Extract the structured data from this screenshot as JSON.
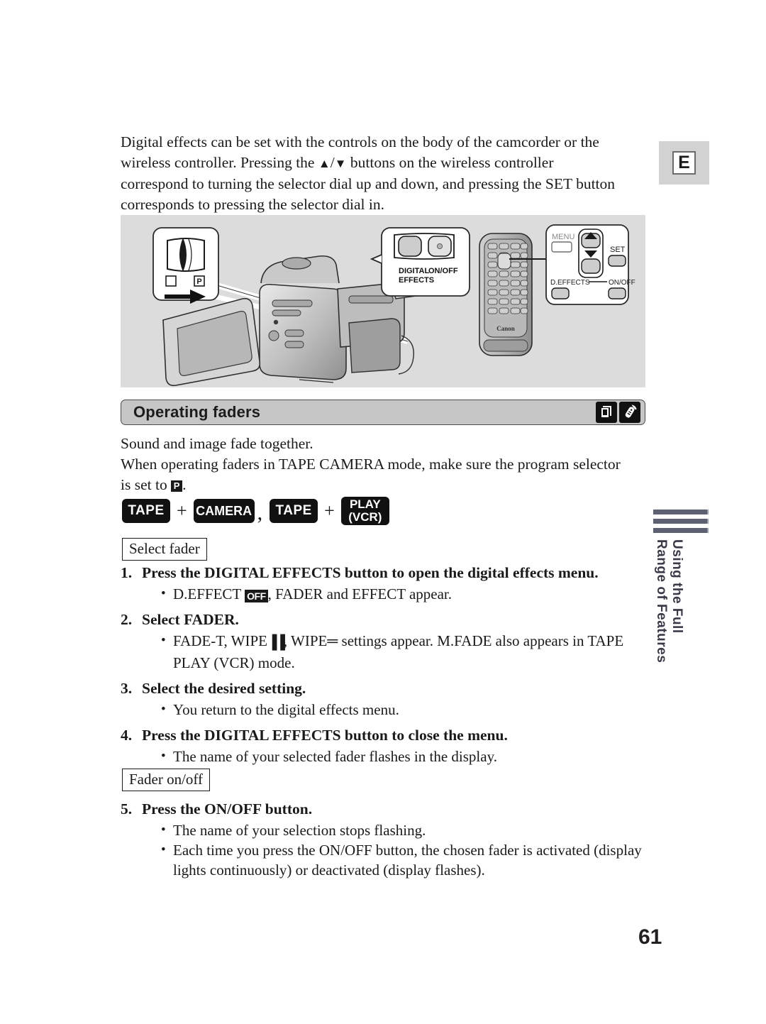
{
  "page": {
    "number": "61",
    "lang_badge": "E"
  },
  "intro": {
    "line1": "Digital effects can be set with the controls on the body of the camcorder or the",
    "line2_a": "wireless controller. Pressing the ",
    "up_arrow": "▲",
    "slash": "/",
    "down_arrow": "▼",
    "line2_b": " buttons on the wireless controller",
    "line3": "correspond to turning the selector dial up and down, and pressing the SET button",
    "line4": "corresponds to pressing the selector dial in."
  },
  "diagram": {
    "program_selector_label_p": "P",
    "camcorder_buttons": {
      "digital_label_line1": "DIGITAL",
      "digital_label_line2": "EFFECTS",
      "onoff_label": "ON/OFF"
    },
    "remote_callout": {
      "menu_label": "MENU",
      "set_label": "SET",
      "deffects_label": "D.EFFECTS",
      "onoff_label": "ON/OFF"
    },
    "remote_brand": "Canon"
  },
  "section": {
    "title": "Operating faders",
    "icon_camcorder": "camcorder-tape-icon",
    "icon_remote": "wireless-controller-icon"
  },
  "body": {
    "line1": "Sound and image fade together.",
    "line2": "When operating faders in TAPE CAMERA mode, make sure the program selector",
    "line3_a": "is set to ",
    "line3_glyph": "P",
    "line3_b": "."
  },
  "modes": {
    "tape1": "TAPE",
    "plus1": "+",
    "camera": "CAMERA",
    "comma": ",",
    "tape2": "TAPE",
    "plus2": "+",
    "play_line1": "PLAY",
    "play_line2": "(VCR)"
  },
  "tags": {
    "select_fader": "Select fader",
    "fader_onoff": "Fader on/off"
  },
  "steps": [
    {
      "num": "1.",
      "title": "Press the DIGITAL EFFECTS button to open the digital effects menu.",
      "bullets": [
        {
          "prefix": "D.EFFECT ",
          "glyph": "OFF",
          "suffix": ", FADER and EFFECT appear."
        }
      ]
    },
    {
      "num": "2.",
      "title": "Select FADER.",
      "bullets": [
        {
          "prefix": "FADE-T, WIPE",
          "glyph_v": "▐▐",
          "mid": ", WIPE",
          "glyph_h": "═",
          "suffix": " settings appear. M.FADE also appears in TAPE PLAY (VCR) mode."
        }
      ]
    },
    {
      "num": "3.",
      "title": "Select the desired setting.",
      "bullets": [
        {
          "text": "You return to the digital effects menu."
        }
      ]
    },
    {
      "num": "4.",
      "title": "Press the DIGITAL EFFECTS button to close the menu.",
      "bullets": [
        {
          "text": "The name of your selected fader flashes in the display."
        }
      ]
    },
    {
      "num": "5.",
      "title": "Press the ON/OFF button.",
      "bullets": [
        {
          "text": "The name of your selection stops flashing."
        },
        {
          "text": "Each time you press the ON/OFF button, the chosen fader is activated (display lights continuously) or deactivated (display flashes)."
        }
      ]
    }
  ],
  "sidebar": {
    "line1": "Using the Full",
    "line2": "Range of Features"
  },
  "colors": {
    "diagram_bg": "#dcdcdc",
    "header_bg": "#c6c6c6",
    "sidebar_bar": "#5d6070",
    "text": "#1a1a1a"
  }
}
